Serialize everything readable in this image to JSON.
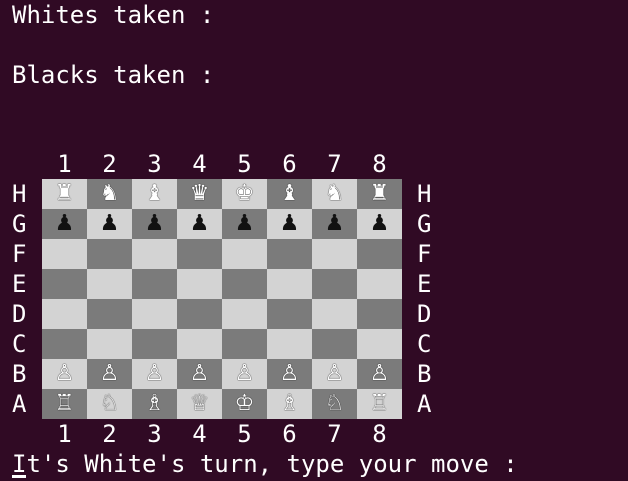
{
  "whites_taken_label": "Whites taken :",
  "blacks_taken_label": "Blacks taken :",
  "prompt": "It's White's turn, type your move :",
  "column_labels": [
    "1",
    "2",
    "3",
    "4",
    "5",
    "6",
    "7",
    "8"
  ],
  "row_labels": [
    "H",
    "G",
    "F",
    "E",
    "D",
    "C",
    "B",
    "A"
  ],
  "board": [
    [
      "♜",
      "♞",
      "♝",
      "♛",
      "♚",
      "♝",
      "♞",
      "♜"
    ],
    [
      "♟",
      "♟",
      "♟",
      "♟",
      "♟",
      "♟",
      "♟",
      "♟"
    ],
    [
      "",
      "",
      "",
      "",
      "",
      "",
      "",
      ""
    ],
    [
      "",
      "",
      "",
      "",
      "",
      "",
      "",
      ""
    ],
    [
      "",
      "",
      "",
      "",
      "",
      "",
      "",
      ""
    ],
    [
      "",
      "",
      "",
      "",
      "",
      "",
      "",
      ""
    ],
    [
      "♙",
      "♙",
      "♙",
      "♙",
      "♙",
      "♙",
      "♙",
      "♙"
    ],
    [
      "♖",
      "♘",
      "♗",
      "♕",
      "♔",
      "♗",
      "♘",
      "♖"
    ]
  ],
  "piece_colors": [
    [
      "w",
      "w",
      "w",
      "w",
      "w",
      "w",
      "w",
      "w"
    ],
    [
      "b",
      "b",
      "b",
      "b",
      "b",
      "b",
      "b",
      "b"
    ],
    [
      "",
      "",
      "",
      "",
      "",
      "",
      "",
      ""
    ],
    [
      "",
      "",
      "",
      "",
      "",
      "",
      "",
      ""
    ],
    [
      "",
      "",
      "",
      "",
      "",
      "",
      "",
      ""
    ],
    [
      "",
      "",
      "",
      "",
      "",
      "",
      "",
      ""
    ],
    [
      "w",
      "w",
      "w",
      "w",
      "w",
      "w",
      "w",
      "w"
    ],
    [
      "w",
      "w",
      "w",
      "w",
      "w",
      "w",
      "w",
      "w"
    ]
  ],
  "colors": {
    "background": "#300a24",
    "text": "#ffffff",
    "light_square": "#d3d3d3",
    "dark_square": "#7b7b7b"
  }
}
